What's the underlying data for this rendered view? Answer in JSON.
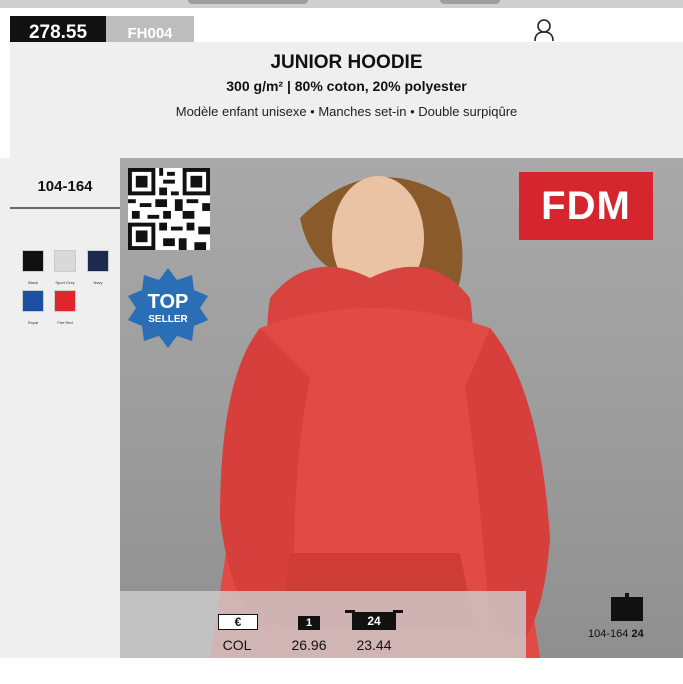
{
  "header": {
    "page_code": "278.55",
    "product_code": "FH004",
    "icon": "person-outline-icon"
  },
  "product": {
    "title": "JUNIOR HOODIE",
    "subtitle": "300 g/m² | 80% coton, 20% polyester",
    "features": "Modèle enfant unisexe • Manches set-in • Double surpiqûre"
  },
  "sidebar": {
    "size_range": "104-164",
    "colors": [
      {
        "name": "Black",
        "hex": "#111111"
      },
      {
        "name": "Sport Grey",
        "hex": "#d9d9d9"
      },
      {
        "name": "Navy",
        "hex": "#1b2a4e"
      },
      {
        "name": "Royal",
        "hex": "#1c4fa3"
      },
      {
        "name": "Fire Red",
        "hex": "#e0262c"
      }
    ]
  },
  "photo": {
    "brand": "FDM",
    "brand_color": "#d6262d",
    "badge_top": "TOP",
    "badge_bottom": "SELLER",
    "badge_color": "#2a6fb5",
    "qr_icon": "qr-code-icon"
  },
  "pricing": {
    "currency_label": "€",
    "col_label": "COL",
    "qty_1_label": "1",
    "qty_1_price": "26.96",
    "qty_24_label": "24",
    "qty_24_price": "23.44"
  },
  "packaging": {
    "icon": "box-icon",
    "sizes": "104-164",
    "quantity": "24"
  }
}
